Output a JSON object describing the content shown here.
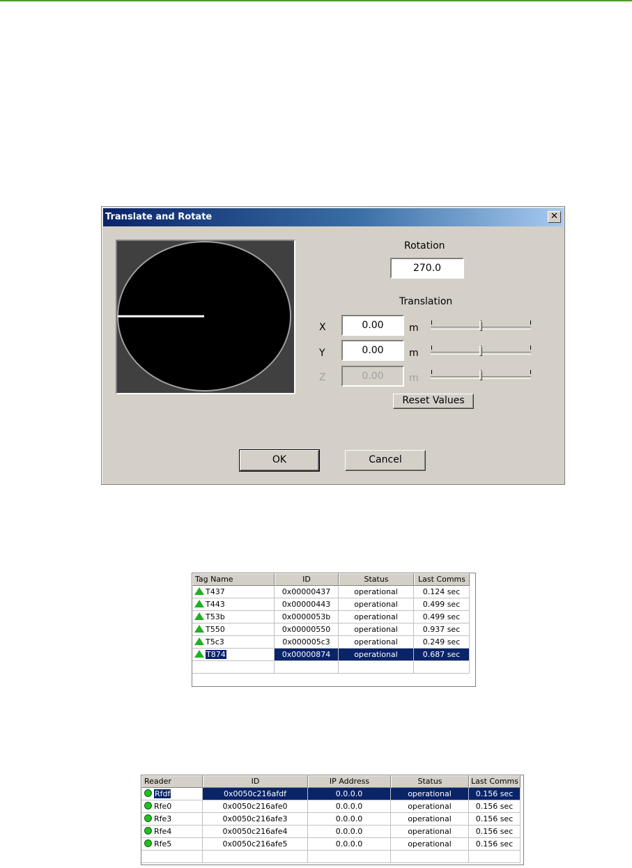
{
  "dialog": {
    "title": "Translate and Rotate",
    "close_glyph": "✕",
    "rotation": {
      "label": "Rotation",
      "value": "270.0"
    },
    "translation": {
      "label": "Translation",
      "x": {
        "axis": "X",
        "value": "0.00",
        "unit": "m",
        "enabled": true,
        "slider_level": 0.5
      },
      "y": {
        "axis": "Y",
        "value": "0.00",
        "unit": "m",
        "enabled": true,
        "slider_level": 0.5
      },
      "z": {
        "axis": "Z",
        "value": "0.00",
        "unit": "m",
        "enabled": false,
        "slider_level": 0.5
      }
    },
    "reset_label": "Reset Values",
    "ok_label": "OK",
    "cancel_label": "Cancel",
    "preview_rotation_deg": 270
  },
  "tags_table": {
    "columns": [
      "Tag Name",
      "ID",
      "Status",
      "Last Comms"
    ],
    "rows": [
      {
        "name": "T437",
        "id": "0x00000437",
        "status": "operational",
        "last": "0.124 sec",
        "selected": false
      },
      {
        "name": "T443",
        "id": "0x00000443",
        "status": "operational",
        "last": "0.499 sec",
        "selected": false
      },
      {
        "name": "T53b",
        "id": "0x0000053b",
        "status": "operational",
        "last": "0.499 sec",
        "selected": false
      },
      {
        "name": "T550",
        "id": "0x00000550",
        "status": "operational",
        "last": "0.937 sec",
        "selected": false
      },
      {
        "name": "T5c3",
        "id": "0x000005c3",
        "status": "operational",
        "last": "0.249 sec",
        "selected": false
      },
      {
        "name": "T874",
        "id": "0x00000874",
        "status": "operational",
        "last": "0.687 sec",
        "selected": true
      }
    ]
  },
  "readers_table": {
    "columns": [
      "Reader",
      "ID",
      "IP Address",
      "Status",
      "Last Comms"
    ],
    "rows": [
      {
        "name": "Rfdf",
        "id": "0x0050c216afdf",
        "ip": "0.0.0.0",
        "status": "operational",
        "last": "0.156 sec",
        "selected": true
      },
      {
        "name": "Rfe0",
        "id": "0x0050c216afe0",
        "ip": "0.0.0.0",
        "status": "operational",
        "last": "0.156 sec",
        "selected": false
      },
      {
        "name": "Rfe3",
        "id": "0x0050c216afe3",
        "ip": "0.0.0.0",
        "status": "operational",
        "last": "0.156 sec",
        "selected": false
      },
      {
        "name": "Rfe4",
        "id": "0x0050c216afe4",
        "ip": "0.0.0.0",
        "status": "operational",
        "last": "0.156 sec",
        "selected": false
      },
      {
        "name": "Rfe5",
        "id": "0x0050c216afe5",
        "ip": "0.0.0.0",
        "status": "operational",
        "last": "0.156 sec",
        "selected": false
      }
    ]
  },
  "colors": {
    "dialog_face": "#d4d0c8",
    "title_gradient_start": "#0a246a",
    "title_gradient_end": "#a6caf0",
    "selection": "#0a246a",
    "status_ok": "#22b022"
  }
}
